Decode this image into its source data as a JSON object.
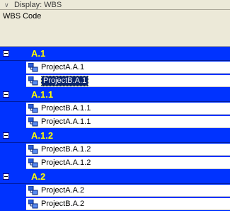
{
  "display_bar": {
    "label": "Display: WBS",
    "expand_icon": "chevron-down-icon"
  },
  "column_header": {
    "title": "WBS Code"
  },
  "colors": {
    "group_background": "#0033ff",
    "group_text": "#ffff00",
    "selection_background": "#0a246a"
  },
  "groups": [
    {
      "title": "A.1",
      "items": [
        {
          "label": "ProjectA.A.1",
          "selected": false
        },
        {
          "label": "ProjectB.A.1",
          "selected": true
        }
      ]
    },
    {
      "title": "A.1.1",
      "items": [
        {
          "label": "ProjectB.A.1.1",
          "selected": false
        },
        {
          "label": "ProjectA.A.1.1",
          "selected": false
        }
      ]
    },
    {
      "title": "A.1.2",
      "items": [
        {
          "label": "ProjectB.A.1.2",
          "selected": false
        },
        {
          "label": "ProjectA.A.1.2",
          "selected": false
        }
      ]
    },
    {
      "title": "A.2",
      "items": [
        {
          "label": "ProjectA.A.2",
          "selected": false
        },
        {
          "label": "ProjectB.A.2",
          "selected": false
        }
      ]
    }
  ]
}
